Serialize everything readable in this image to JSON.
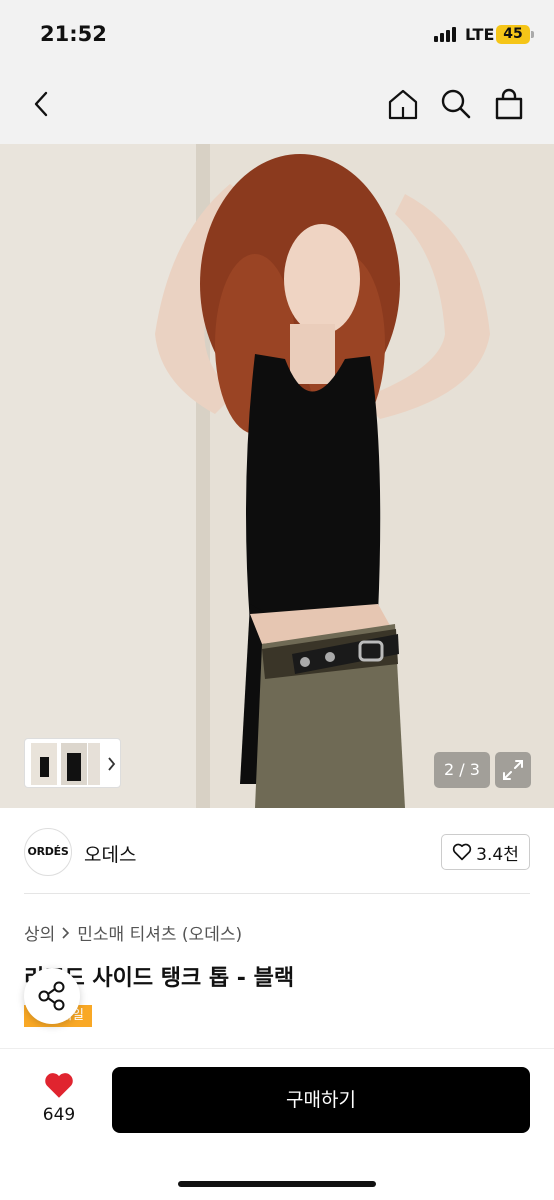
{
  "status": {
    "time": "21:52",
    "network": "LTE",
    "battery": "45"
  },
  "gallery": {
    "counter": "2 / 3"
  },
  "brand": {
    "logo_text": "ORDÉS",
    "name": "오데스",
    "likes": "3.4천"
  },
  "breadcrumb": {
    "level1": "상의",
    "level2": "민소매 티셔츠 (오데스)"
  },
  "product": {
    "title": "리포드 사이드 탱크 톱 - 블랙",
    "badge": "무료 세일"
  },
  "bottom_bar": {
    "wish_count": "649",
    "buy_label": "구매하기"
  },
  "colors": {
    "accent": "#f9a825",
    "heart": "#e0242f",
    "buy_bg": "#000000"
  }
}
